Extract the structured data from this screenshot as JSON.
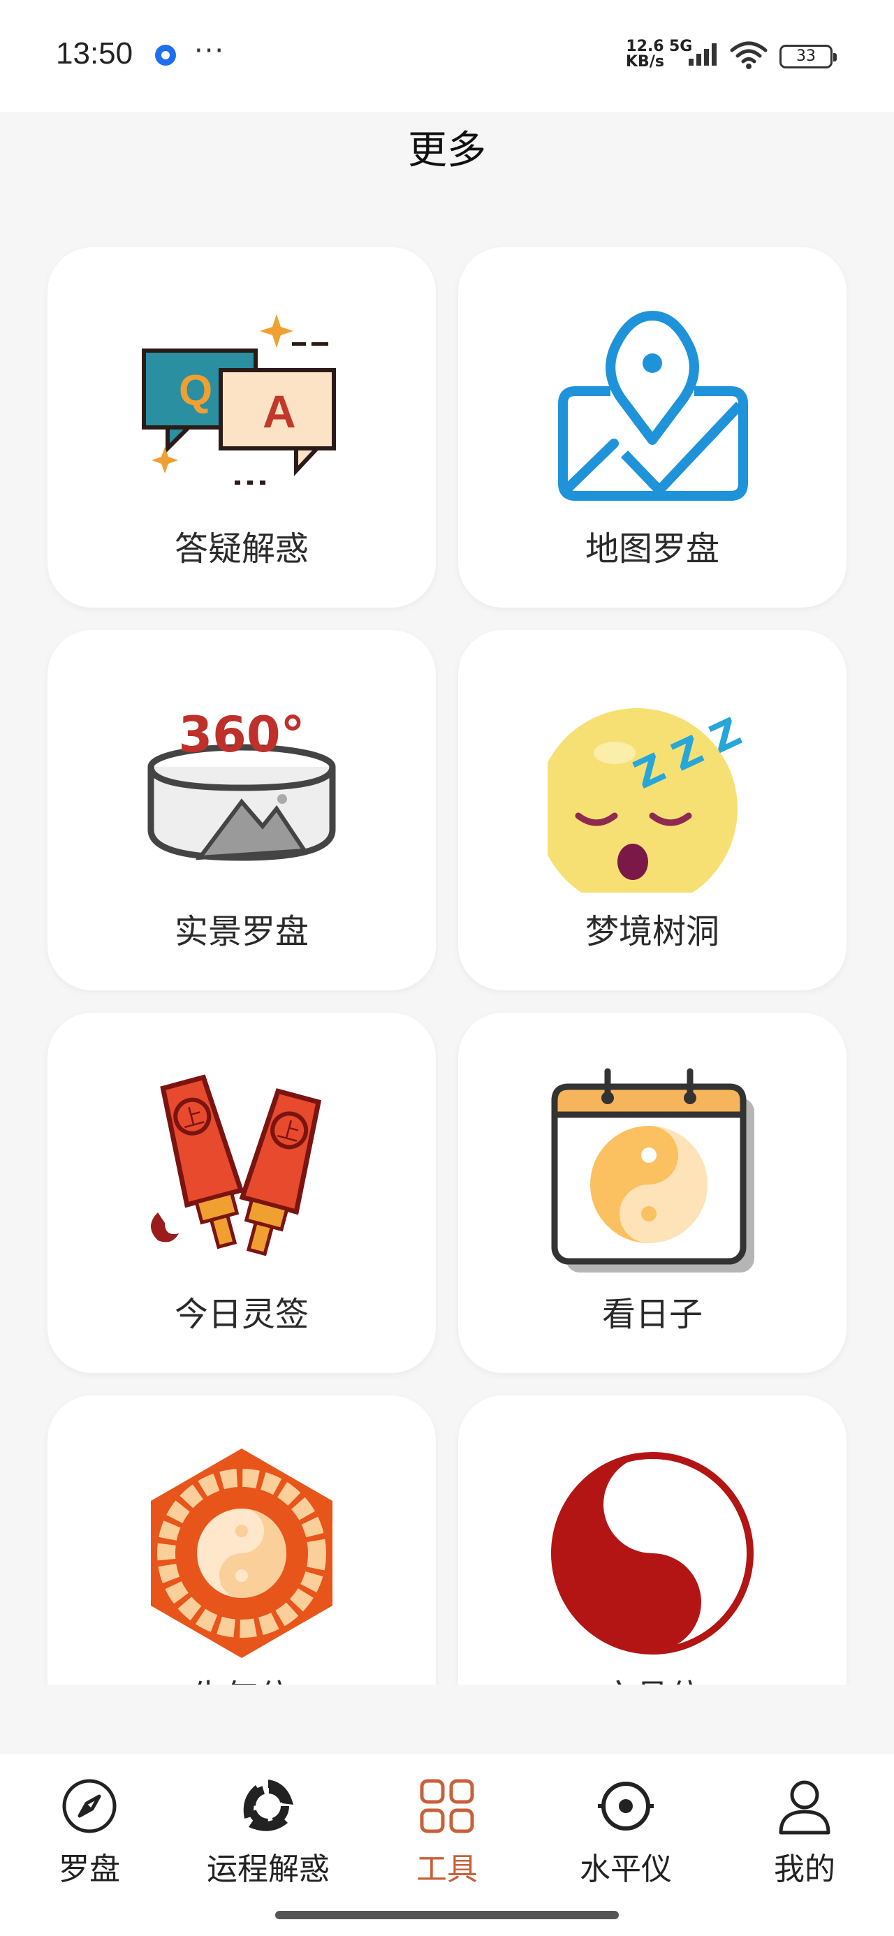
{
  "status_bar": {
    "time": "13:50",
    "more": "···",
    "net_speed_top": "12.6",
    "net_speed_bottom": "KB/s",
    "network": "5G",
    "battery": "33"
  },
  "header": {
    "title": "更多"
  },
  "tools": [
    {
      "label": "答疑解惑",
      "icon": "qa-icon"
    },
    {
      "label": "地图罗盘",
      "icon": "map-pin-icon"
    },
    {
      "label": "实景罗盘",
      "icon": "panorama-360-icon",
      "icon_text": "360°"
    },
    {
      "label": "梦境树洞",
      "icon": "sleeping-face-icon",
      "icon_text": "Z Z Z"
    },
    {
      "label": "今日灵签",
      "icon": "fortune-sticks-icon",
      "icon_text": "上"
    },
    {
      "label": "看日子",
      "icon": "calendar-yinyang-icon"
    },
    {
      "label": "生气位",
      "icon": "bagua-icon"
    },
    {
      "label": "文昌位",
      "icon": "red-yinyang-icon"
    }
  ],
  "bottom_nav": [
    {
      "label": "罗盘",
      "icon": "compass-icon",
      "active": false
    },
    {
      "label": "运程解惑",
      "icon": "fortune-swirl-icon",
      "active": false
    },
    {
      "label": "工具",
      "icon": "grid-icon",
      "active": true
    },
    {
      "label": "水平仪",
      "icon": "level-icon",
      "active": false
    },
    {
      "label": "我的",
      "icon": "profile-icon",
      "active": false
    }
  ],
  "colors": {
    "accent": "#c8603a",
    "background": "#f6f6f6",
    "card": "#ffffff"
  }
}
